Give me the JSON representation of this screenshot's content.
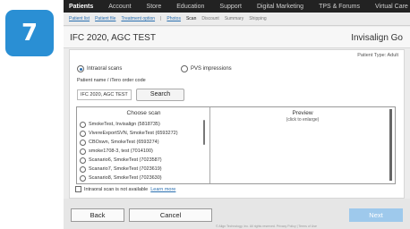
{
  "step": {
    "number": "7"
  },
  "topnav": {
    "items": [
      "Patients",
      "Account",
      "Store",
      "Education",
      "Support",
      "Digital Marketing",
      "TPS & Forums",
      "Virtual Care"
    ],
    "active_index": 0
  },
  "subnav": {
    "patient_list": "Patient list",
    "patient_file": "Patient file",
    "treatment_option": "Treatment option",
    "separator": "|",
    "photos": "Photos",
    "scan": "Scan",
    "discount": "Discount",
    "summary": "Summary",
    "shipping": "Shipping"
  },
  "header": {
    "title": "IFC 2020, AGC TEST",
    "product": "Invisalign Go"
  },
  "panel": {
    "patient_type": "Patient Type: Adult",
    "intraoral_label": "Intraoral scans",
    "pvs_label": "PVS impressions",
    "field_label": "Patient name / iTero order code",
    "order_value": "IFC 2020, AGC TEST",
    "search_label": "Search",
    "choose_title": "Choose scan",
    "scans": [
      "SmokeTest, Invisalign (5818735)",
      "VivereExportSVN, SmokeTest (6593272)",
      "CBOswn, SmokeTest (6593274)",
      "smoke1708-3, test (7014100)",
      "Scanario6, SmokeTest (7023587)",
      "Scanario7, SmokeTest (7023619)",
      "Scanario8, SmokeTest (7023630)"
    ],
    "preview_title": "Preview",
    "preview_hint": "(click to enlarge)",
    "unavailable_text": "Intraoral scan is not available",
    "learn_more": "Learn more"
  },
  "footer": {
    "back": "Back",
    "cancel": "Cancel",
    "next": "Next",
    "copyright": "© Align Technology, Inc. All rights reserved. Privacy Policy | Terms of Use"
  },
  "colors": {
    "badge": "#2a8fd4",
    "nav_bg": "#222222",
    "link": "#2a6fb0",
    "next_disabled": "#9ec9ec"
  }
}
